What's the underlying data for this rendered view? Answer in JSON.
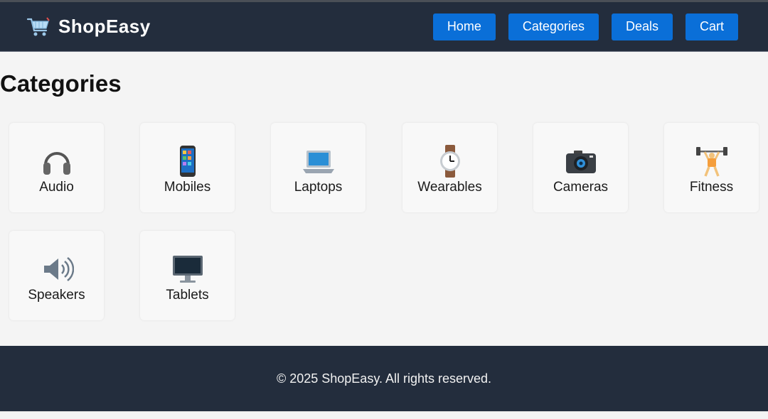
{
  "header": {
    "brand_icon": "shopping-cart-icon",
    "brand_name": "ShopEasy",
    "nav": [
      {
        "label": "Home"
      },
      {
        "label": "Categories"
      },
      {
        "label": "Deals"
      },
      {
        "label": "Cart"
      }
    ]
  },
  "main": {
    "title": "Categories",
    "categories": [
      {
        "label": "Audio",
        "icon": "headphones-icon"
      },
      {
        "label": "Mobiles",
        "icon": "mobile-phone-icon"
      },
      {
        "label": "Laptops",
        "icon": "laptop-icon"
      },
      {
        "label": "Wearables",
        "icon": "watch-icon"
      },
      {
        "label": "Cameras",
        "icon": "camera-icon"
      },
      {
        "label": "Fitness",
        "icon": "weightlifter-icon"
      },
      {
        "label": "Speakers",
        "icon": "speaker-icon"
      },
      {
        "label": "Tablets",
        "icon": "monitor-icon"
      }
    ]
  },
  "footer": {
    "copyright": "© 2025 ShopEasy. All rights reserved."
  },
  "colors": {
    "header_bg": "#232d3d",
    "nav_button": "#0a6fd8",
    "page_bg": "#f4f4f4"
  }
}
